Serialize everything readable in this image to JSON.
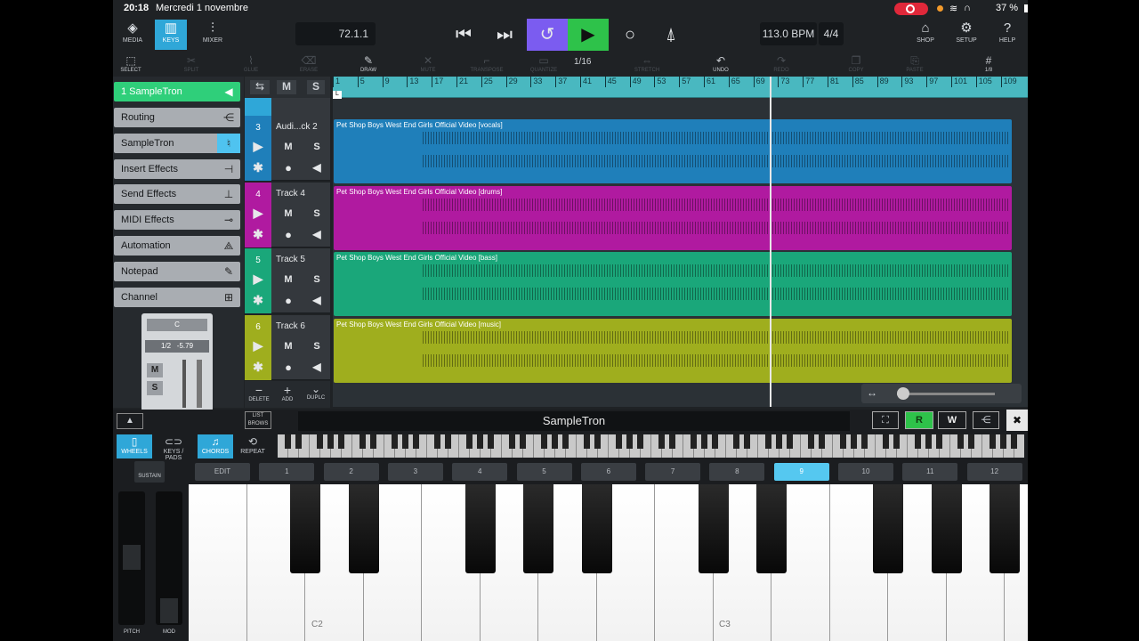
{
  "status": {
    "time": "20:18",
    "date": "Mercredi 1 novembre",
    "battery": "37 %"
  },
  "toolbar": {
    "media": "MEDIA",
    "keys": "KEYS",
    "mixer": "MIXER",
    "position": "72.1.1",
    "tempo": "113.0 BPM",
    "signature": "4/4",
    "shop": "SHOP",
    "setup": "SETUP",
    "help": "HELP"
  },
  "tools": {
    "select": "SELECT",
    "split": "SPLIT",
    "glue": "GLUE",
    "erase": "ERASE",
    "draw": "DRAW",
    "mute": "MUTE",
    "transpose": "TRANSPOSE",
    "quantize": "QUANTIZE",
    "quantize_value": "1/16",
    "stretch": "STRETCH",
    "undo": "UNDO",
    "redo": "REDO",
    "copy": "COPY",
    "paste": "PASTE",
    "grid_value": "1/8"
  },
  "inspector": {
    "track": "1  SampleTron",
    "routing": "Routing",
    "instrument": "SampleTron",
    "insert": "Insert Effects",
    "send": "Send Effects",
    "midi": "MIDI Effects",
    "automation": "Automation",
    "notepad": "Notepad",
    "channel": "Channel",
    "strip_pan": "C",
    "strip_route": "1/2",
    "strip_db": "-5.79",
    "strip_m": "M",
    "strip_s": "S"
  },
  "tracks": [
    {
      "num": "3",
      "name": "Audi...ck 2",
      "clip": "Pet Shop Boys  West End Girls Official Video [vocals]",
      "color": "#1f7fba"
    },
    {
      "num": "4",
      "name": "Track 4",
      "clip": "Pet Shop Boys  West End Girls Official Video [drums]",
      "color": "#b01aa0"
    },
    {
      "num": "5",
      "name": "Track 5",
      "clip": "Pet Shop Boys  West End Girls Official Video [bass]",
      "color": "#1aa77a"
    },
    {
      "num": "6",
      "name": "Track 6",
      "clip": "Pet Shop Boys  West End Girls Official Video [music]",
      "color": "#9fae1e"
    }
  ],
  "track_buttons": {
    "m": "M",
    "s": "S",
    "delete": "DELETE",
    "add": "ADD",
    "duplicate": "DUPLC"
  },
  "ruler": [
    "1",
    "5",
    "9",
    "13",
    "17",
    "21",
    "25",
    "29",
    "33",
    "37",
    "41",
    "45",
    "49",
    "53",
    "57",
    "61",
    "65",
    "69",
    "73",
    "77",
    "81",
    "85",
    "89",
    "93",
    "97",
    "101",
    "105",
    "109"
  ],
  "keys": {
    "instrument": "SampleTron",
    "list": "LIST",
    "browse": "BROWS",
    "r": "R",
    "w": "W",
    "wheels": "WHEELS",
    "keypads": "KEYS / PADS",
    "chords": "CHORDS",
    "repeat": "REPEAT",
    "sustain": "SUSTAIN",
    "pitch": "PITCH",
    "mod": "MOD",
    "c2": "C2",
    "c3": "C3"
  },
  "chord_buttons": [
    "EDIT",
    "1",
    "2",
    "3",
    "4",
    "5",
    "6",
    "7",
    "8",
    "9",
    "10",
    "11",
    "12"
  ],
  "icons": [
    "media-icon",
    "keys-icon",
    "mixer-icon",
    "rewind-icon",
    "forward-icon",
    "cycle-icon",
    "play-icon",
    "record-icon",
    "metronome-icon",
    "shop-icon",
    "setup-icon",
    "help-icon"
  ],
  "colors": {
    "accent": "#2fa7d8",
    "cycle": "#7b5cf0",
    "play": "#2ec24a",
    "chord_active": "#55c8f0"
  }
}
